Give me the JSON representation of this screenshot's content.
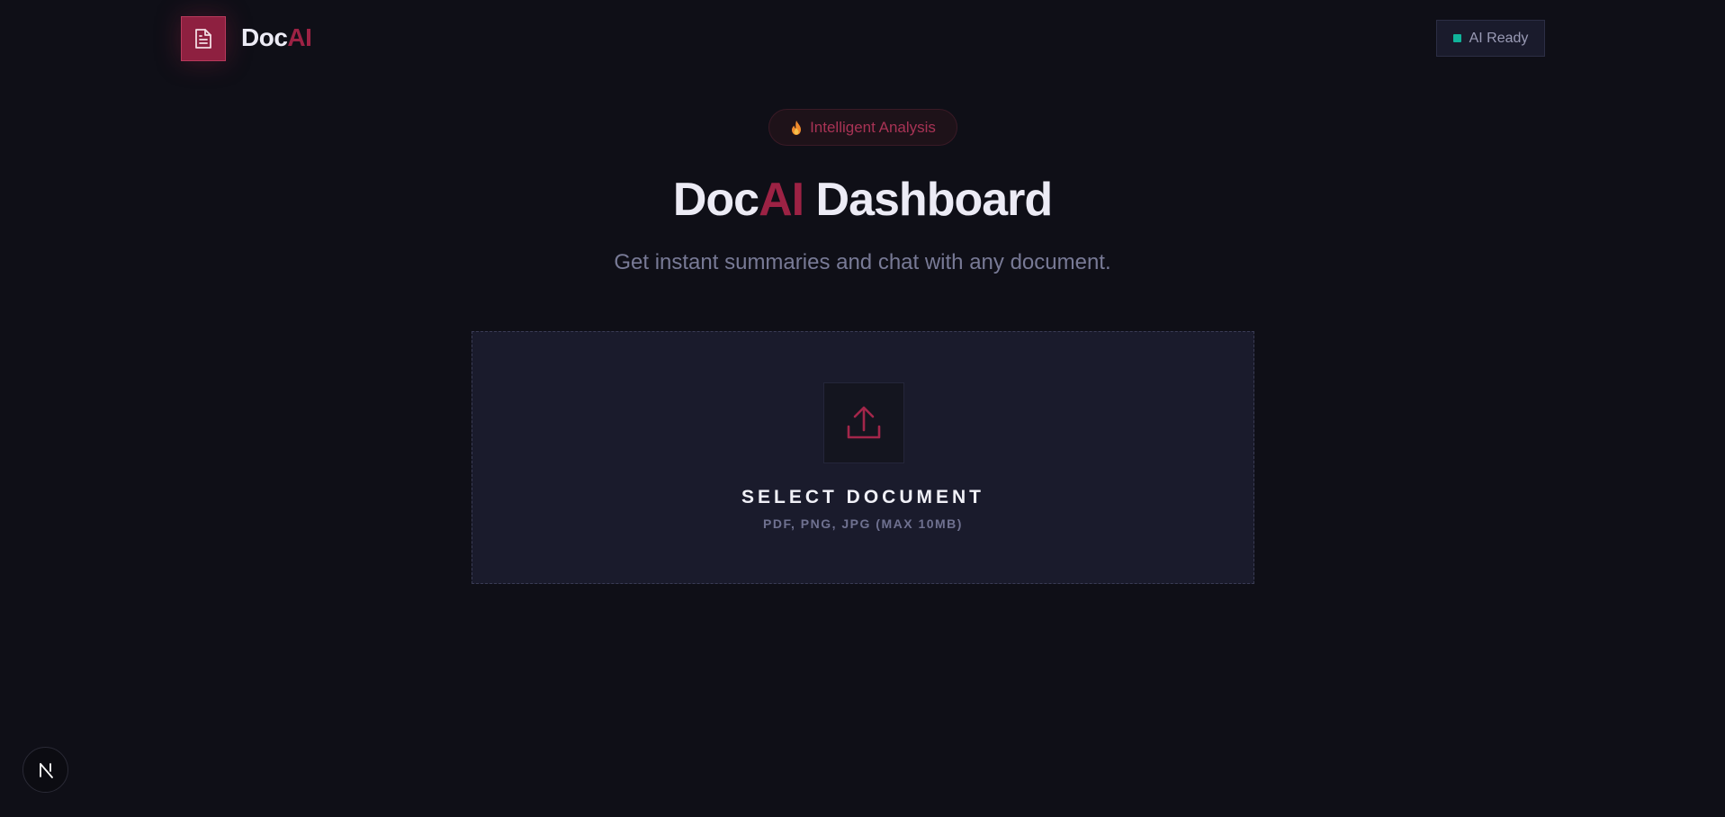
{
  "header": {
    "logo_icon": "document-icon",
    "logo_part1": "Doc",
    "logo_part2": "AI",
    "status": {
      "label": "AI Ready",
      "color": "#10b39a"
    }
  },
  "hero": {
    "badge": {
      "icon": "flame-icon",
      "label": "Intelligent Analysis"
    },
    "title_part1": "Doc",
    "title_part2": "AI",
    "title_part3": " Dashboard",
    "subtitle": "Get instant summaries and chat with any document."
  },
  "upload": {
    "icon": "upload-icon",
    "title": "SELECT DOCUMENT",
    "formats": "PDF, PNG, JPG (MAX 10MB)"
  },
  "colors": {
    "background": "#0f0f17",
    "accent": "#9c2244",
    "panel": "#1a1b2c"
  },
  "footer": {
    "dev_indicator_icon": "nextjs-icon"
  }
}
